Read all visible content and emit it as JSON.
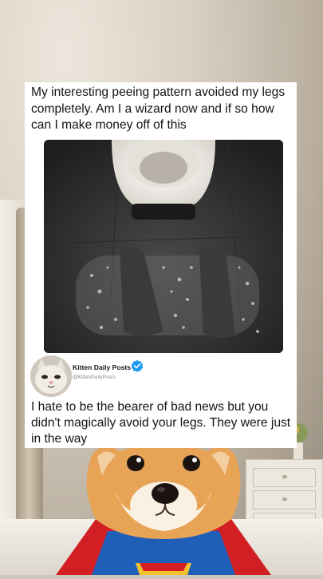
{
  "post": {
    "text": "My interesting peeing pattern avoided my legs completely. Am I a wizard now and if so how can I make money off of this",
    "image_alt": "toilet-floor-photo"
  },
  "reply": {
    "account_name": "Kitten Daily Posts",
    "account_handle": "@KittenDailyPosts",
    "verified": true,
    "text": "I hate to be the bearer of bad news but you didn't magically avoid your legs. They were just in the way"
  },
  "colors": {
    "card_background": "#ffffff",
    "text": "#141414",
    "verified_badge": "#1d9bf0",
    "superhero_suit": "#1f5fb8",
    "superhero_cape": "#d11f24"
  }
}
